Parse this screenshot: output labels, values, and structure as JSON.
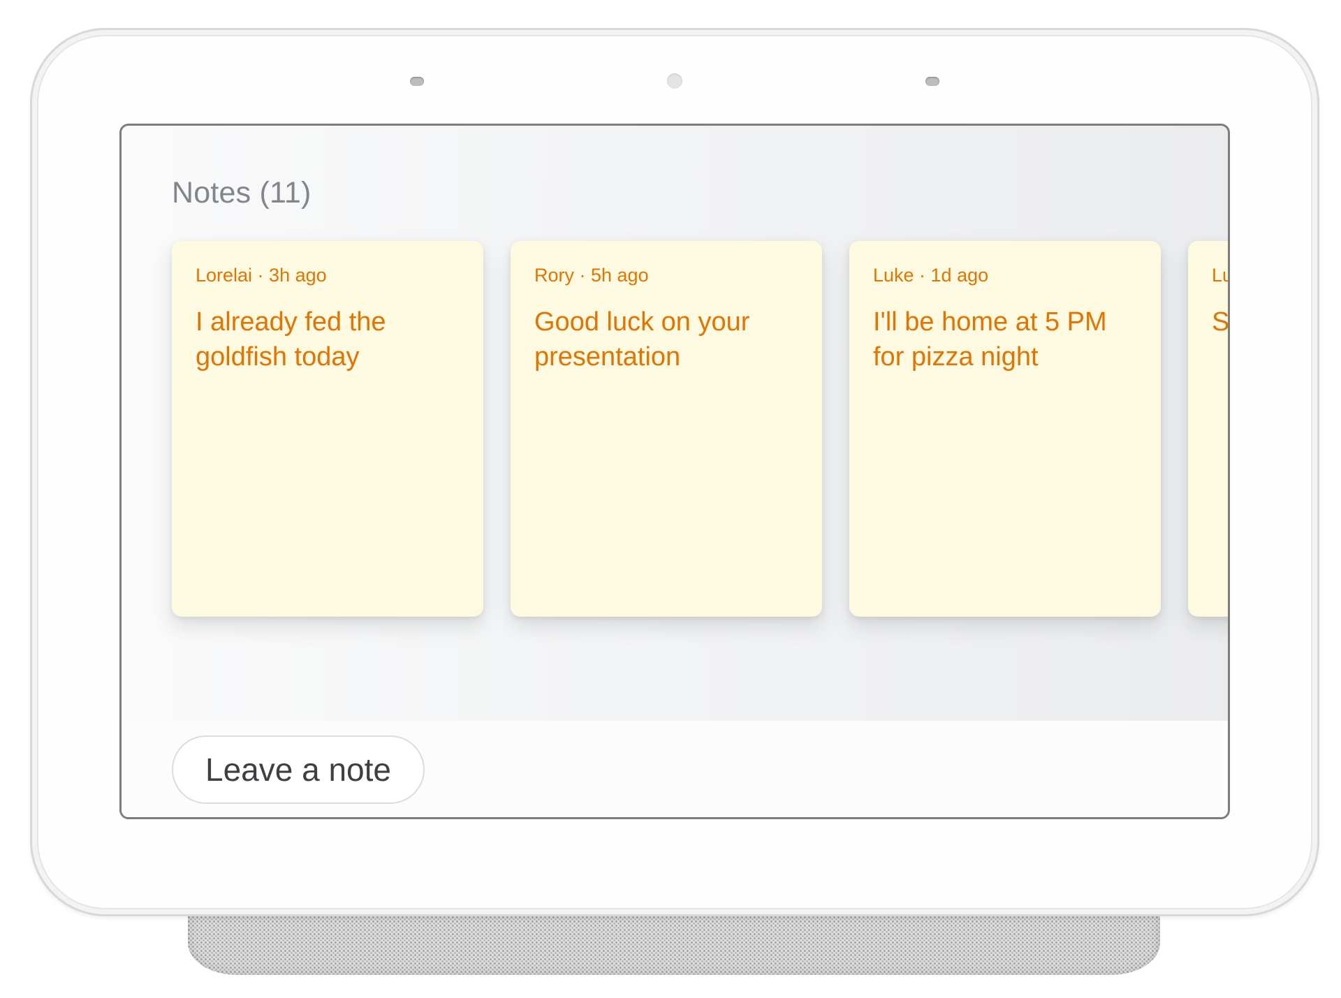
{
  "screen": {
    "title": "Notes (11)"
  },
  "notes": [
    {
      "meta": "Lorelai · 3h ago",
      "body": "I already fed the goldfish today"
    },
    {
      "meta": "Rory · 5h ago",
      "body": "Good luck on your presentation"
    },
    {
      "meta": "Luke · 1d ago",
      "body": "I'll be home at 5 PM for pizza night"
    },
    {
      "meta": "Lu",
      "body": "S a"
    }
  ],
  "footer": {
    "leave_note_label": "Leave a note"
  },
  "colors": {
    "note_background": "#fef9e1",
    "note_text": "#e37400",
    "title_text": "#80868b"
  }
}
